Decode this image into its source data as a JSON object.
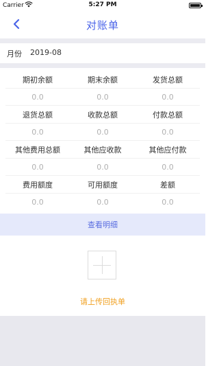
{
  "status": {
    "carrier": "Carrier",
    "wifi_icon": "wifi-icon",
    "time": "5:27 PM",
    "battery_icon": "battery-icon"
  },
  "nav": {
    "back_icon": "chevron-left-icon",
    "title": "对账单"
  },
  "month": {
    "label": "月份",
    "value": "2019-08"
  },
  "grid": {
    "rows": [
      [
        {
          "label": "期初余额",
          "value": "0.0"
        },
        {
          "label": "期末余额",
          "value": "0.0"
        },
        {
          "label": "发货总额",
          "value": "0.0"
        }
      ],
      [
        {
          "label": "退货总额",
          "value": "0.0"
        },
        {
          "label": "收款总额",
          "value": "0.0"
        },
        {
          "label": "付款总额",
          "value": "0.0"
        }
      ],
      [
        {
          "label": "其他费用总额",
          "value": "0.0"
        },
        {
          "label": "其他应收款",
          "value": "0.0"
        },
        {
          "label": "其他应付款",
          "value": "0.0"
        }
      ],
      [
        {
          "label": "费用额度",
          "value": "0.0"
        },
        {
          "label": "可用额度",
          "value": "0.0"
        },
        {
          "label": "差额",
          "value": "0.0"
        }
      ]
    ]
  },
  "detail_button": "查看明细",
  "upload": {
    "icon": "plus-icon",
    "label": "请上传回执单"
  },
  "colors": {
    "accent": "#4a63e8",
    "upload_text": "#f0a020",
    "detail_bg": "#e5e9fb"
  }
}
